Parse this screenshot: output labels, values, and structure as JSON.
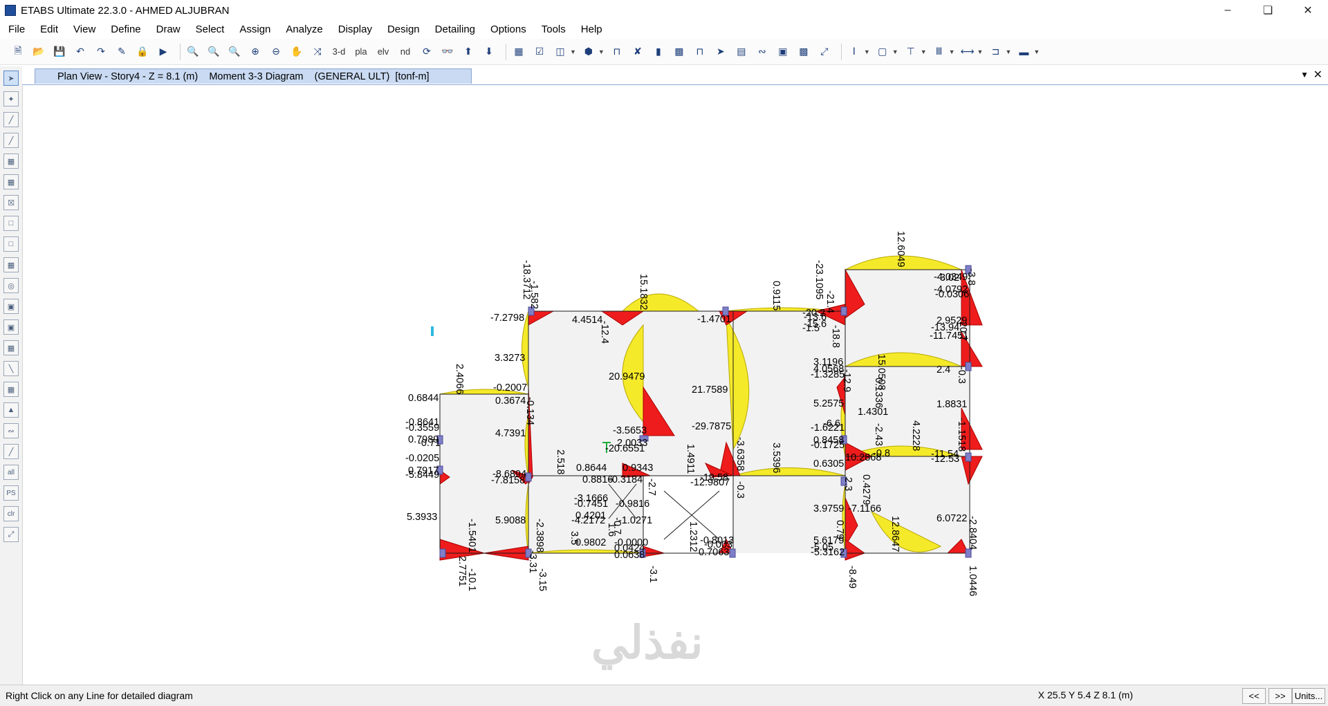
{
  "window": {
    "title": "ETABS Ultimate 22.3.0 - AHMED ALJUBRAN"
  },
  "menu": [
    "File",
    "Edit",
    "View",
    "Define",
    "Draw",
    "Select",
    "Assign",
    "Analyze",
    "Display",
    "Design",
    "Detailing",
    "Options",
    "Tools",
    "Help"
  ],
  "toolbar": {
    "view_3d": "3-d",
    "view_plan": "pla",
    "view_elev": "elv",
    "view_nd": "nd"
  },
  "view_tab": {
    "label": "Plan View - Story4 - Z = 8.1 (m)    Moment 3-3 Diagram    (GENERAL ULT)  [tonf-m]"
  },
  "status": {
    "message": "Right Click on any Line for detailed diagram",
    "coords": "X 25.5  Y 5.4  Z 8.1 (m)",
    "prev": "<<",
    "next": ">>",
    "units": "Units..."
  },
  "sidebar": {
    "all": "all",
    "ps": "PS",
    "clr": "clr"
  },
  "watermark": "نفذلي",
  "diagram": {
    "labels_h": [
      [
        "-7.2798",
        709,
        464
      ],
      [
        "4.4514",
        827,
        467
      ],
      [
        "3.3273",
        715,
        522
      ],
      [
        "20.9479",
        880,
        549
      ],
      [
        "21.7589",
        1000,
        568
      ],
      [
        "-1.4701",
        1008,
        466
      ],
      [
        "-29.7875",
        1000,
        621
      ],
      [
        "-3.5653",
        886,
        627
      ],
      [
        "2.0033",
        892,
        645
      ],
      [
        "-20.6551",
        875,
        653
      ],
      [
        "-0.2007",
        713,
        565
      ],
      [
        "0.3674",
        716,
        584
      ],
      [
        "4.7391",
        716,
        631
      ],
      [
        "0.6844",
        590,
        580
      ],
      [
        "-0.8641",
        586,
        615
      ],
      [
        "-0.3559",
        586,
        623
      ],
      [
        "0.7989",
        590,
        640
      ],
      [
        "-0.71",
        604,
        645
      ],
      [
        "-0.0205",
        586,
        667
      ],
      [
        "0.7917",
        590,
        685
      ],
      [
        "-5.8449",
        586,
        691
      ],
      [
        "-8.6894",
        712,
        690
      ],
      [
        "-7.8158",
        710,
        699
      ],
      [
        "0.8644",
        833,
        681
      ],
      [
        "0.9343",
        900,
        681
      ],
      [
        "0.8816",
        842,
        698
      ],
      [
        "-0.3184",
        880,
        698
      ],
      [
        "-3.1666",
        830,
        725
      ],
      [
        "-0.7451",
        830,
        733
      ],
      [
        "-0.9816",
        890,
        733
      ],
      [
        "0.4201",
        832,
        750
      ],
      [
        "-4.2172",
        826,
        757
      ],
      [
        "-1.0271",
        894,
        757
      ],
      [
        "0.9802",
        832,
        789
      ],
      [
        "-0.0000",
        888,
        789
      ],
      [
        "0.0424",
        888,
        797
      ],
      [
        "0.0638",
        888,
        807
      ],
      [
        "5.3933",
        588,
        752
      ],
      [
        "5.9088",
        716,
        757
      ],
      [
        "-19.58",
        1012,
        695
      ],
      [
        "-12.9807",
        998,
        702
      ],
      [
        "-0.8013",
        1012,
        786
      ],
      [
        "-0.003",
        1018,
        792
      ],
      [
        "0.7063",
        1010,
        803
      ],
      [
        "-20.2",
        1160,
        457
      ],
      [
        "-13.6",
        1162,
        463
      ],
      [
        "-15.6",
        1162,
        473
      ],
      [
        "-1.5",
        1160,
        479
      ],
      [
        "3.1196",
        1176,
        528
      ],
      [
        "4.0568",
        1176,
        538
      ],
      [
        "-1.3285",
        1172,
        546
      ],
      [
        "5.2575",
        1176,
        588
      ],
      [
        "-1.6221",
        1172,
        623
      ],
      [
        "-6.6",
        1190,
        617
      ],
      [
        "0.8458",
        1176,
        641
      ],
      [
        "-0.1725",
        1172,
        648
      ],
      [
        "0.6305",
        1176,
        675
      ],
      [
        "10.2868",
        1222,
        666
      ],
      [
        "-0.8",
        1262,
        660
      ],
      [
        "1.4301",
        1240,
        600
      ],
      [
        "3.9759",
        1176,
        740
      ],
      [
        "-7.1166",
        1226,
        740
      ],
      [
        "5.6179",
        1176,
        786
      ],
      [
        "-5.3162",
        1172,
        803
      ],
      [
        "-5.05",
        1172,
        796
      ],
      [
        "-4.0349",
        1350,
        405
      ],
      [
        "-3.02",
        1354,
        406
      ],
      [
        "-4.0792",
        1350,
        423
      ],
      [
        "-0.0306",
        1352,
        430
      ],
      [
        "2.9529",
        1354,
        468
      ],
      [
        "-13.94",
        1346,
        478
      ],
      [
        "-11.7451",
        1344,
        490
      ],
      [
        "2.4",
        1354,
        539
      ],
      [
        "1.8831",
        1354,
        589
      ],
      [
        "-11.54",
        1346,
        661
      ],
      [
        "-12.53",
        1346,
        668
      ],
      [
        "6.0722",
        1354,
        754
      ]
    ],
    "labels_v": [
      [
        "-18.3712",
        757,
        376
      ],
      [
        "-1.582",
        768,
        406
      ],
      [
        "15.1832",
        926,
        396
      ],
      [
        "-12.4",
        870,
        464
      ],
      [
        "0.9115",
        1118,
        406
      ],
      [
        "-23.1095",
        1180,
        376
      ],
      [
        "-21.4",
        1196,
        420
      ],
      [
        "-18.8",
        1204,
        470
      ],
      [
        "12.6049",
        1298,
        334
      ],
      [
        "-3.8",
        1400,
        388
      ],
      [
        "-20.7",
        1388,
        460
      ],
      [
        "15.0508",
        1270,
        512
      ],
      [
        "0.1336",
        1266,
        546
      ],
      [
        "-2.43",
        1266,
        612
      ],
      [
        "4.2228",
        1320,
        608
      ],
      [
        "-1.1518",
        1386,
        604
      ],
      [
        "-12.9",
        1220,
        534
      ],
      [
        "-0.3",
        1386,
        530
      ],
      [
        "2.4066",
        660,
        526
      ],
      [
        "-0.134",
        762,
        574
      ],
      [
        "2.518",
        806,
        650
      ],
      [
        "1.4911",
        994,
        642
      ],
      [
        "3.5396",
        1118,
        640
      ],
      [
        "-3.6358",
        1066,
        632
      ],
      [
        "3.5",
        826,
        768
      ],
      [
        "1.2312",
        998,
        754
      ],
      [
        "-0.3",
        1066,
        696
      ],
      [
        "-1.5401",
        678,
        750
      ],
      [
        "2.7751",
        664,
        804
      ],
      [
        "-10.1",
        678,
        822
      ],
      [
        "-2.3898",
        776,
        750
      ],
      [
        "-3.31",
        766,
        796
      ],
      [
        "-3.15",
        780,
        822
      ],
      [
        "0.4279",
        1248,
        686
      ],
      [
        "12.8647",
        1290,
        746
      ],
      [
        "-2.8404",
        1402,
        746
      ],
      [
        "1.0446",
        1402,
        818
      ],
      [
        "-8.49",
        1228,
        818
      ],
      [
        "0.79",
        1210,
        752
      ],
      [
        "2.3",
        1222,
        690
      ],
      [
        "-2.7",
        938,
        692
      ],
      [
        "-3.1",
        940,
        818
      ],
      [
        "-0.7",
        888,
        748
      ],
      [
        "1.6",
        880,
        756
      ]
    ]
  }
}
